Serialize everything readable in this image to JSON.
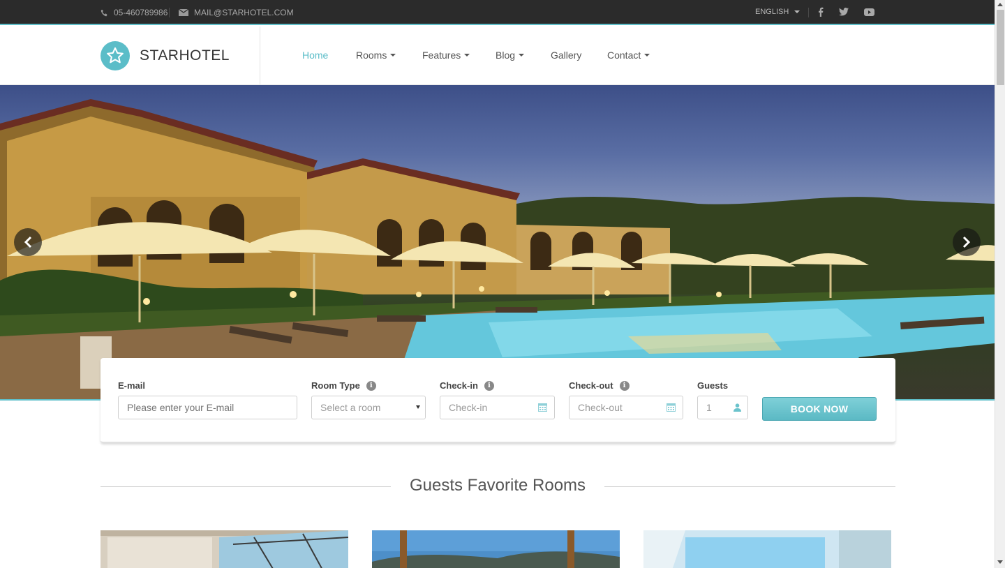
{
  "topbar": {
    "phone": "05-460789986",
    "email": "MAIL@STARHOTEL.COM",
    "language": "ENGLISH"
  },
  "brand": {
    "name": "STARHOTEL",
    "accent": "#5bbdc8"
  },
  "nav": [
    {
      "label": "Home",
      "active": true
    },
    {
      "label": "Rooms",
      "dropdown": true
    },
    {
      "label": "Features",
      "dropdown": true
    },
    {
      "label": "Blog",
      "dropdown": true
    },
    {
      "label": "Gallery"
    },
    {
      "label": "Contact",
      "dropdown": true
    }
  ],
  "booking": {
    "email_label": "E-mail",
    "email_placeholder": "Please enter your E-mail",
    "room_label": "Room Type",
    "room_value": "Select a room",
    "checkin_label": "Check-in",
    "checkin_placeholder": "Check-in",
    "checkout_label": "Check-out",
    "checkout_placeholder": "Check-out",
    "guests_label": "Guests",
    "guests_value": "1",
    "submit": "BOOK NOW"
  },
  "section": {
    "title": "Guests Favorite Rooms"
  },
  "icons": {
    "phone": "phone-icon",
    "email": "envelope-icon",
    "facebook": "facebook-icon",
    "twitter": "twitter-icon",
    "youtube": "youtube-icon",
    "logo": "star-icon",
    "calendar": "calendar-icon",
    "user": "user-icon",
    "info": "info-icon"
  }
}
